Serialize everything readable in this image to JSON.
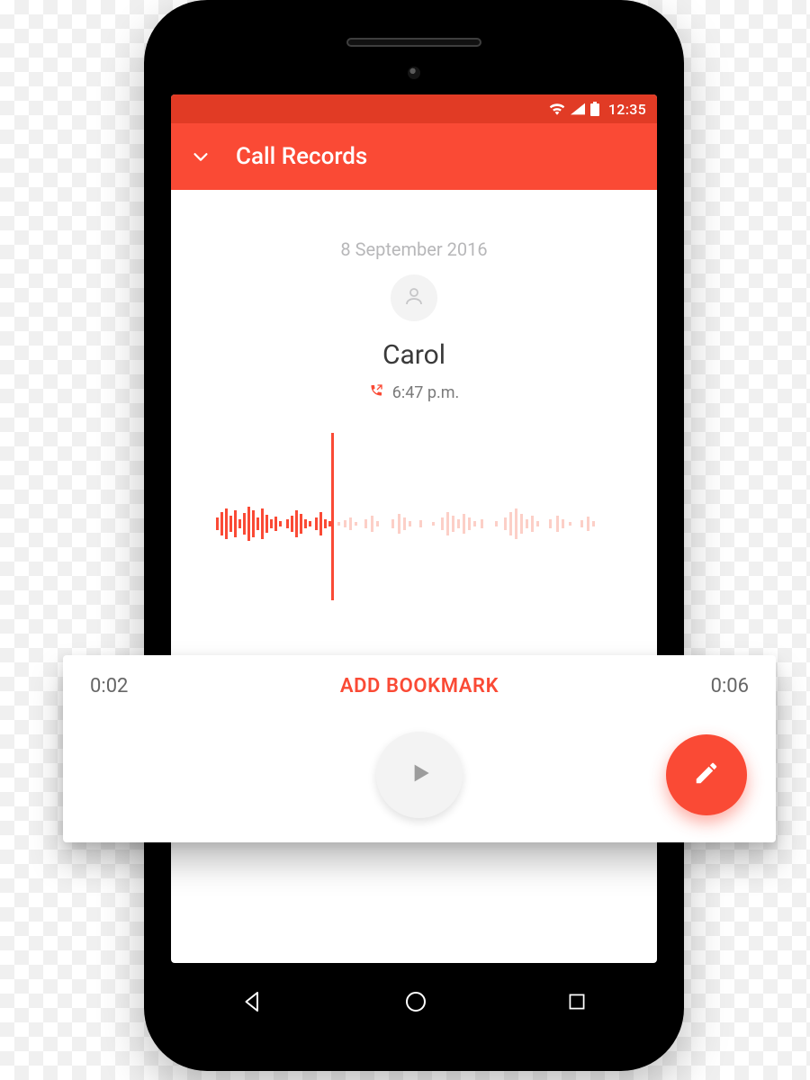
{
  "status": {
    "time": "12:35"
  },
  "appbar": {
    "title": "Call Records"
  },
  "detail": {
    "date": "8 September 2016",
    "contact_name": "Carol",
    "call_time": "6:47 p.m.",
    "call_direction": "outgoing"
  },
  "playback": {
    "elapsed": "0:02",
    "total": "0:06",
    "bookmark_label": "ADD BOOKMARK",
    "playhead_ratio": 0.33
  },
  "colors": {
    "accent": "#FA4A35",
    "accent_dark": "#E13B25"
  },
  "icons": {
    "chevron": "chevron-down-icon",
    "avatar": "person-icon",
    "call": "outgoing-call-icon",
    "play": "play-icon",
    "edit": "pencil-icon",
    "wifi": "wifi-icon",
    "signal": "cell-signal-icon",
    "battery": "battery-icon",
    "nav_back": "nav-back-icon",
    "nav_home": "nav-home-icon",
    "nav_recent": "nav-recent-icon"
  }
}
